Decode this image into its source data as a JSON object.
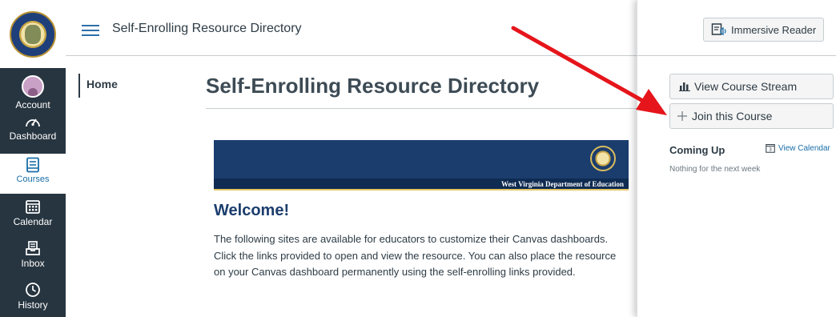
{
  "header": {
    "title": "Self-Enrolling Resource Directory"
  },
  "global_nav": {
    "items": [
      {
        "label": "Account",
        "icon": "avatar"
      },
      {
        "label": "Dashboard",
        "icon": "dashboard-icon"
      },
      {
        "label": "Courses",
        "icon": "courses-icon",
        "active": true
      },
      {
        "label": "Calendar",
        "icon": "calendar-icon"
      },
      {
        "label": "Inbox",
        "icon": "inbox-icon"
      },
      {
        "label": "History",
        "icon": "history-icon"
      }
    ]
  },
  "course_nav": {
    "home_label": "Home"
  },
  "main": {
    "page_title": "Self-Enrolling Resource Directory",
    "banner_text": "West Virginia Department of Education",
    "welcome_heading": "Welcome!",
    "intro_text": "The following sites are available for educators to customize their Canvas dashboards. Click the links provided to open and view the resource. You can also place the resource on your Canvas dashboard permanently using the self-enrolling links provided."
  },
  "sidebar": {
    "immersive_reader_label": "Immersive Reader",
    "view_stream_label": "View Course Stream",
    "join_course_label": "Join this Course",
    "coming_up_title": "Coming Up",
    "view_calendar_label": "View Calendar",
    "calendar_day": "3",
    "nothing_text": "Nothing for the next week"
  },
  "colors": {
    "nav_bg": "#273540",
    "link": "#1a6ea8",
    "banner_bg": "#1b3d6d",
    "annotation_arrow": "#e5151b"
  }
}
